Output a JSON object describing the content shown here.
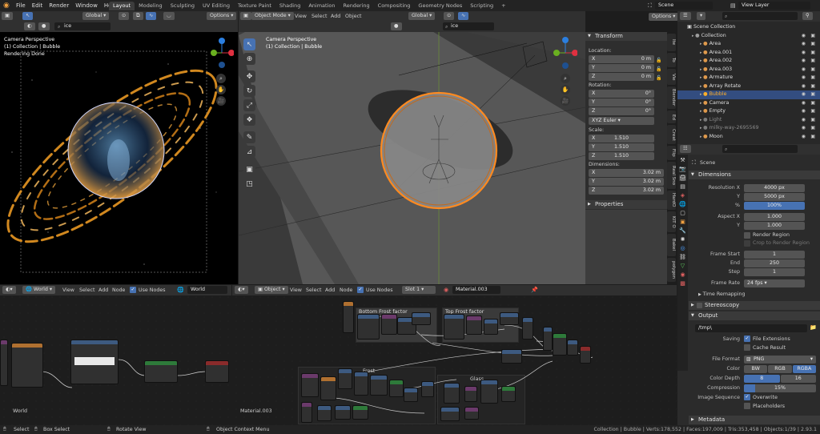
{
  "topbar": {
    "menus": [
      "File",
      "Edit",
      "Render",
      "Window",
      "Help"
    ],
    "workspaces": [
      "Layout",
      "Modeling",
      "Sculpting",
      "UV Editing",
      "Texture Paint",
      "Shading",
      "Animation",
      "Rendering",
      "Compositing",
      "Geometry Nodes",
      "Scripting"
    ],
    "active_workspace": "Layout",
    "scene": "Scene",
    "view_layer": "View Layer"
  },
  "render_view": {
    "header_transform": "Global",
    "options": "Options",
    "search": "ice",
    "overlay_lines": [
      "Camera Perspective",
      "(1) Collection | Bubble",
      "Rendering Done"
    ]
  },
  "viewport": {
    "mode": "Object Mode",
    "menus": [
      "View",
      "Select",
      "Add",
      "Object"
    ],
    "transform": "Global",
    "options": "Options",
    "search": "ice",
    "overlay_lines": [
      "Camera Perspective",
      "(1) Collection | Bubble"
    ]
  },
  "npanel": {
    "transform_title": "Transform",
    "location_label": "Location:",
    "location": [
      {
        "axis": "X",
        "value": "0 m"
      },
      {
        "axis": "Y",
        "value": "0 m"
      },
      {
        "axis": "Z",
        "value": "0 m"
      }
    ],
    "rotation_label": "Rotation:",
    "rotation": [
      {
        "axis": "X",
        "value": "0°"
      },
      {
        "axis": "Y",
        "value": "0°"
      },
      {
        "axis": "Z",
        "value": "0°"
      }
    ],
    "rotation_mode": "XYZ Euler",
    "scale_label": "Scale:",
    "scale": [
      {
        "axis": "X",
        "value": "1.510"
      },
      {
        "axis": "Y",
        "value": "1.510"
      },
      {
        "axis": "Z",
        "value": "1.510"
      }
    ],
    "dimensions_label": "Dimensions:",
    "dimensions": [
      {
        "axis": "X",
        "value": "3.02 m"
      },
      {
        "axis": "Y",
        "value": "3.02 m"
      },
      {
        "axis": "Z",
        "value": "3.02 m"
      }
    ],
    "properties_title": "Properties",
    "side_tabs": [
      "Ite",
      "To",
      "Vie",
      "Blender",
      "Ed",
      "Creat",
      "Flip",
      "Real Sno",
      "HardO",
      "KIT O",
      "Bakel",
      "polygon"
    ]
  },
  "outliner": {
    "title": "Scene Collection",
    "items": [
      {
        "name": "Collection",
        "level": 0,
        "color": "#9d9d9d"
      },
      {
        "name": "Area",
        "level": 1,
        "color": "#e09a4c"
      },
      {
        "name": "Area.001",
        "level": 1,
        "color": "#e09a4c"
      },
      {
        "name": "Area.002",
        "level": 1,
        "color": "#e09a4c"
      },
      {
        "name": "Area.003",
        "level": 1,
        "color": "#e09a4c"
      },
      {
        "name": "Armature",
        "level": 1,
        "color": "#e09a4c"
      },
      {
        "name": "Array Rotate",
        "level": 1,
        "color": "#e09a4c"
      },
      {
        "name": "Bubble",
        "level": 1,
        "color": "#ffaf29",
        "selected": true
      },
      {
        "name": "Camera",
        "level": 1,
        "color": "#e09a4c"
      },
      {
        "name": "Empty",
        "level": 1,
        "color": "#e09a4c"
      },
      {
        "name": "Light",
        "level": 1,
        "color": "#7a7a7a"
      },
      {
        "name": "milky-way-2695569",
        "level": 1,
        "color": "#7a7a7a"
      },
      {
        "name": "Moon",
        "level": 1,
        "color": "#e09a4c"
      }
    ]
  },
  "properties": {
    "scene": "Scene",
    "dimensions_title": "Dimensions",
    "resolution_x_label": "Resolution X",
    "resolution_x": "4000 px",
    "y_label": "Y",
    "resolution_y": "5000 px",
    "percent_label": "%",
    "percent": "100%",
    "aspect_x_label": "Aspect X",
    "aspect_x": "1.000",
    "aspect_y": "1.000",
    "render_region": "Render Region",
    "crop_region": "Crop to Render Region",
    "frame_start_label": "Frame Start",
    "frame_start": "1",
    "end_label": "End",
    "frame_end": "250",
    "step_label": "Step",
    "frame_step": "1",
    "frame_rate_label": "Frame Rate",
    "frame_rate": "24 fps",
    "time_remapping": "Time Remapping",
    "stereoscopy": "Stereoscopy",
    "output_title": "Output",
    "output_path": "/tmp\\",
    "saving_label": "Saving",
    "file_extensions": "File Extensions",
    "cache_result": "Cache Result",
    "file_format_label": "File Format",
    "file_format": "PNG",
    "color_label": "Color",
    "color_options": [
      "BW",
      "RGB",
      "RGBA"
    ],
    "color_active": "RGBA",
    "color_depth_label": "Color Depth",
    "color_depth_options": [
      "8",
      "16"
    ],
    "compression_label": "Compression",
    "compression": "15%",
    "compression_fraction": 0.15,
    "image_sequence_label": "Image Sequence",
    "overwrite": "Overwrite",
    "placeholders": "Placeholders",
    "metadata_title": "Metadata"
  },
  "world_editor": {
    "type": "World",
    "menus": [
      "View",
      "Select",
      "Add",
      "Node"
    ],
    "use_nodes": "Use Nodes",
    "world_name": "World",
    "corner_label": "World"
  },
  "material_editor": {
    "object": "Object",
    "menus": [
      "View",
      "Select",
      "Add",
      "Node"
    ],
    "use_nodes": "Use Nodes",
    "slot": "Slot 1",
    "material": "Material.003",
    "frames": [
      "Bottom Frost factor",
      "Top Frost factor",
      "Frost",
      "Glass"
    ],
    "corner_label": "Material.003"
  },
  "statusbar": {
    "items": [
      "Select",
      "Box Select",
      "Rotate View",
      "Object Context Menu"
    ],
    "stats": "Collection | Bubble | Verts:178,552 | Faces:197,009 | Tris:353,458 | Objects:1/39 | 2.93.1"
  },
  "colors": {
    "accent": "#4772b3",
    "selection": "#ffaf29",
    "header": "#303030",
    "panel": "#2b2b2b"
  }
}
